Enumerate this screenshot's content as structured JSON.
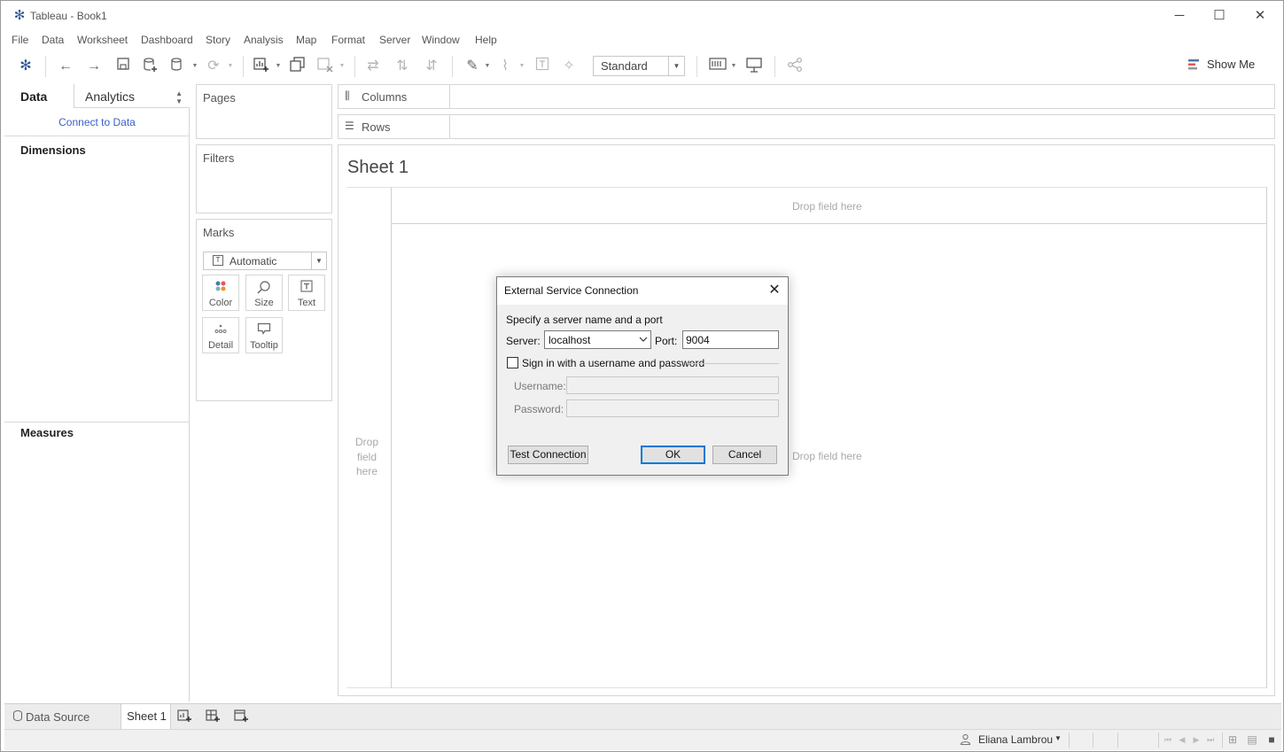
{
  "window": {
    "title": "Tableau - Book1",
    "minimize": "─",
    "maximize": "☐",
    "close": "✕"
  },
  "menu": [
    "File",
    "Data",
    "Worksheet",
    "Dashboard",
    "Story",
    "Analysis",
    "Map",
    "Format",
    "Server",
    "Window",
    "Help"
  ],
  "toolbar": {
    "fit_value": "Standard",
    "show_me": "Show Me",
    "icons": [
      "tableau-logo-icon",
      "undo-icon",
      "redo-icon",
      "save-icon",
      "new-data-source-icon",
      "pause-updates-icon",
      "refresh-icon",
      "new-worksheet-icon",
      "duplicate-icon",
      "clear-icon",
      "swap-icon",
      "sort-ascending-icon",
      "sort-descending-icon",
      "highlight-icon",
      "group-icon",
      "labels-icon",
      "fix-axes-icon",
      "cards-icon",
      "presentation-icon",
      "share-icon"
    ]
  },
  "data_pane": {
    "tab_data": "Data",
    "tab_analytics": "Analytics",
    "connect_link": "Connect to Data",
    "dimensions": "Dimensions",
    "measures": "Measures"
  },
  "shelves": {
    "pages": "Pages",
    "filters": "Filters",
    "marks": "Marks",
    "mark_type": "Automatic",
    "mark_buttons": [
      {
        "label": "Color",
        "icon": "color-icon"
      },
      {
        "label": "Size",
        "icon": "size-icon"
      },
      {
        "label": "Text",
        "icon": "text-icon"
      },
      {
        "label": "Detail",
        "icon": "detail-icon"
      },
      {
        "label": "Tooltip",
        "icon": "tooltip-icon"
      }
    ],
    "columns": "Columns",
    "rows": "Rows"
  },
  "sheet": {
    "title": "Sheet 1",
    "drop_top": "Drop field here",
    "drop_left": "Drop field here",
    "drop_center": "Drop field here"
  },
  "bottom_tabs": {
    "data_source": "Data Source",
    "sheet1": "Sheet 1"
  },
  "status": {
    "user": "Eliana Lambrou"
  },
  "dialog": {
    "title": "External Service Connection",
    "instruction": "Specify a server name and a port",
    "server_label": "Server:",
    "server_value": "localhost",
    "port_label": "Port:",
    "port_value": "9004",
    "signin_label": "Sign in with a username and password",
    "signin_checked": false,
    "username_label": "Username:",
    "password_label": "Password:",
    "test_button": "Test Connection",
    "ok_button": "OK",
    "cancel_button": "Cancel"
  },
  "colors": {
    "link": "#3a5fcd",
    "default_button_border": "#0078d7",
    "dialog_bg": "#f0f0f0"
  }
}
